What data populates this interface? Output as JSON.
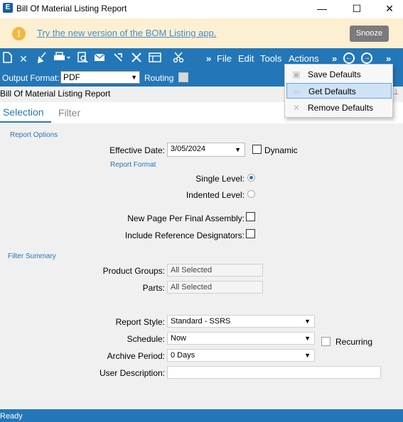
{
  "window": {
    "title": "Bill Of Material Listing Report",
    "app_icon": "E",
    "min": "—",
    "max": "☐",
    "close": "✕"
  },
  "banner": {
    "icon": "!",
    "link": "Try the new version of the BOM Listing app.",
    "snooze": "Snooze"
  },
  "toolbar": {
    "menus": {
      "file": "File",
      "edit": "Edit",
      "tools": "Tools",
      "actions": "Actions"
    },
    "overflow": "»",
    "back": "←",
    "forward": "→"
  },
  "output": {
    "label": "Output Format:",
    "value": "PDF",
    "routing_label": "Routing"
  },
  "report": {
    "title": "Bill Of Material Listing Report"
  },
  "tabs": {
    "selection": "Selection",
    "filter": "Filter"
  },
  "options": {
    "section": "Report Options",
    "effective_date_label": "Effective Date:",
    "effective_date": "3/05/2024",
    "dynamic_label": "Dynamic",
    "format_section": "Report Format",
    "single_level": "Single Level:",
    "indented_level": "Indented Level:",
    "new_page": "New Page Per Final Assembly:",
    "include_ref": "Include Reference Designators:"
  },
  "filter_summary": {
    "section": "Filter Summary",
    "product_groups_label": "Product Groups:",
    "product_groups": "All Selected",
    "parts_label": "Parts:",
    "parts": "All Selected"
  },
  "report_style": {
    "label": "Report Style:",
    "value": "Standard - SSRS"
  },
  "schedule": {
    "label": "Schedule:",
    "value": "Now",
    "recurring": "Recurring"
  },
  "archive": {
    "label": "Archive Period:",
    "value": "0 Days"
  },
  "user_desc": {
    "label": "User Description:",
    "value": ""
  },
  "actions_menu": [
    "Save Defaults",
    "Get Defaults",
    "Remove Defaults"
  ],
  "status": "Ready"
}
